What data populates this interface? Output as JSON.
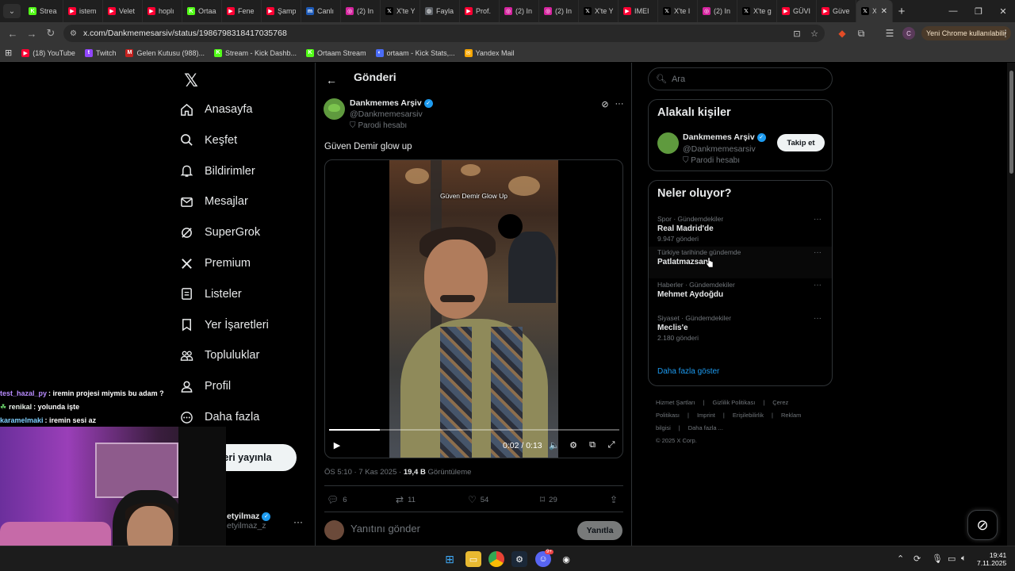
{
  "browser": {
    "tabs": [
      {
        "label": "Strea",
        "icon": "kick-icon",
        "color": "#53fc18"
      },
      {
        "label": "istem",
        "icon": "youtube-icon",
        "color": "#ff0033"
      },
      {
        "label": "Velet",
        "icon": "youtube-icon",
        "color": "#ff0033"
      },
      {
        "label": "hoplı",
        "icon": "youtube-icon",
        "color": "#ff0033"
      },
      {
        "label": "Ortaa",
        "icon": "kick-icon",
        "color": "#53fc18"
      },
      {
        "label": "Fene",
        "icon": "youtube-icon",
        "color": "#ff0033"
      },
      {
        "label": "Şamp",
        "icon": "youtube-icon",
        "color": "#ff0033"
      },
      {
        "label": "Canlı",
        "icon": "m-icon",
        "color": "#1e5bb8"
      },
      {
        "label": "(2) In",
        "icon": "instagram-icon",
        "color": "#d6249f"
      },
      {
        "label": "X'te Y",
        "icon": "x-icon",
        "color": "#000000"
      },
      {
        "label": "Fayla",
        "icon": "globe-icon",
        "color": "#5f6368"
      },
      {
        "label": "Prof.",
        "icon": "youtube-icon",
        "color": "#ff0033"
      },
      {
        "label": "(2) In",
        "icon": "instagram-icon",
        "color": "#d6249f"
      },
      {
        "label": "(2) In",
        "icon": "instagram-icon",
        "color": "#d6249f"
      },
      {
        "label": "X'te Y",
        "icon": "x-icon",
        "color": "#000000"
      },
      {
        "label": "IMEI",
        "icon": "youtube-icon",
        "color": "#ff0033"
      },
      {
        "label": "X'te I",
        "icon": "x-icon",
        "color": "#000000"
      },
      {
        "label": "(2) In",
        "icon": "instagram-icon",
        "color": "#d6249f"
      },
      {
        "label": "X'te g",
        "icon": "x-icon",
        "color": "#000000"
      },
      {
        "label": "GÜVI",
        "icon": "youtube-icon",
        "color": "#ff0033"
      },
      {
        "label": "Güve",
        "icon": "youtube-icon",
        "color": "#ff0033"
      }
    ],
    "active_tab": {
      "label": "X",
      "icon": "x-icon"
    },
    "new_tab_symbol": "+",
    "url": "x.com/Dankmemesarsiv/status/1986798318417035768",
    "promo": "Yeni Chrome kullanılabilir",
    "profile_initial": "C",
    "bookmarks": [
      {
        "label": "(18) YouTube",
        "icon": "youtube-icon",
        "color": "#ff0033",
        "glyph": "▶"
      },
      {
        "label": "Twitch",
        "icon": "twitch-icon",
        "color": "#9146ff",
        "glyph": "t"
      },
      {
        "label": "Gelen Kutusu (988)...",
        "icon": "mail-icon",
        "color": "#c5221f",
        "glyph": "M"
      },
      {
        "label": "Stream - Kick Dashb...",
        "icon": "kick-icon",
        "color": "#53fc18",
        "glyph": "K"
      },
      {
        "label": "Ortaam Stream",
        "icon": "kick-icon",
        "color": "#53fc18",
        "glyph": "K"
      },
      {
        "label": "ortaam - Kick Stats,...",
        "icon": "stats-icon",
        "color": "#4a6cf7",
        "glyph": "◐"
      },
      {
        "label": "Yandex Mail",
        "icon": "yandex-mail-icon",
        "color": "#f7a600",
        "glyph": "✉"
      }
    ]
  },
  "x": {
    "nav": [
      {
        "label": "Anasayfa",
        "icon": "home-icon"
      },
      {
        "label": "Keşfet",
        "icon": "search-icon"
      },
      {
        "label": "Bildirimler",
        "icon": "bell-icon"
      },
      {
        "label": "Mesajlar",
        "icon": "mail-icon"
      },
      {
        "label": "SuperGrok",
        "icon": "grok-icon"
      },
      {
        "label": "Premium",
        "icon": "x-icon"
      },
      {
        "label": "Listeler",
        "icon": "list-icon"
      },
      {
        "label": "Yer İşaretleri",
        "icon": "bookmark-icon"
      },
      {
        "label": "Topluluklar",
        "icon": "communities-icon"
      },
      {
        "label": "Profil",
        "icon": "person-icon"
      },
      {
        "label": "Daha fazla",
        "icon": "more-circle-icon"
      }
    ],
    "post_button": "eri yayınla",
    "account": {
      "name": "etyilmaz",
      "handle": "etyilmaz_z"
    },
    "page_title": "Gönderi",
    "post": {
      "author_name": "Dankmemes Arşiv",
      "author_handle": "@Dankmemesarsiv",
      "parody_label": "Parodi hesabı",
      "text": "Güven Demir glow up",
      "video_caption": "Güven Demir Glow Up",
      "video_time": "0:02 / 0:13",
      "video_progress": 0.1736,
      "time": "ÖS 5:10",
      "date": "7 Kas 2025",
      "views": "19,4 B",
      "views_label": "Görüntüleme",
      "replies": "6",
      "reposts": "11",
      "likes": "54",
      "bookmarks": "29"
    },
    "reply": {
      "placeholder": "Yanıtını gönder",
      "button": "Yanıtla"
    },
    "search_placeholder": "Ara",
    "relevant": {
      "title": "Alakalı kişiler",
      "name": "Dankmemes Arşiv",
      "handle": "@Dankmemesarsiv",
      "parody_label": "Parodi hesabı",
      "follow": "Takip et"
    },
    "trends": {
      "title": "Neler oluyor?",
      "items": [
        {
          "context": "Spor · Gündemdekiler",
          "name": "Real Madrid'de",
          "count": "9.947 gönderi"
        },
        {
          "context": "Türkiye tarihinde gündemde",
          "name": "Patlatmazsan",
          "count": ""
        },
        {
          "context": "Haberler · Gündemdekiler",
          "name": "Mehmet Aydoğdu",
          "count": ""
        },
        {
          "context": "Siyaset · Gündemdekiler",
          "name": "Meclis'e",
          "count": "2.180 gönderi"
        }
      ],
      "show_more": "Daha fazla göster"
    },
    "footer": {
      "links": [
        "Hizmet Şartları",
        "|",
        "Gizlilik Politikası",
        "|",
        "Çerez Politikası",
        "|",
        "Imprint",
        "|",
        "Erişilebilirlik",
        "|",
        "Reklam bilgisi",
        "|",
        "Daha fazla ..."
      ],
      "copyright": "© 2025 X Corp."
    }
  },
  "stream": {
    "chat": [
      {
        "user": "test_hazal_py",
        "color": "#b98cff",
        "message": ": iremin projesi miymis bu adam ?"
      },
      {
        "user": "renikal",
        "color": "#e8f0e8",
        "message": ": yolunda işte",
        "prefix": "☘"
      },
      {
        "user": "karamelmaki",
        "color": "#7fd0ff",
        "message": ": iremin sesi az"
      }
    ]
  },
  "taskbar": {
    "time": "19:41",
    "date": "7.11.2025",
    "discord_badge": "9+"
  }
}
